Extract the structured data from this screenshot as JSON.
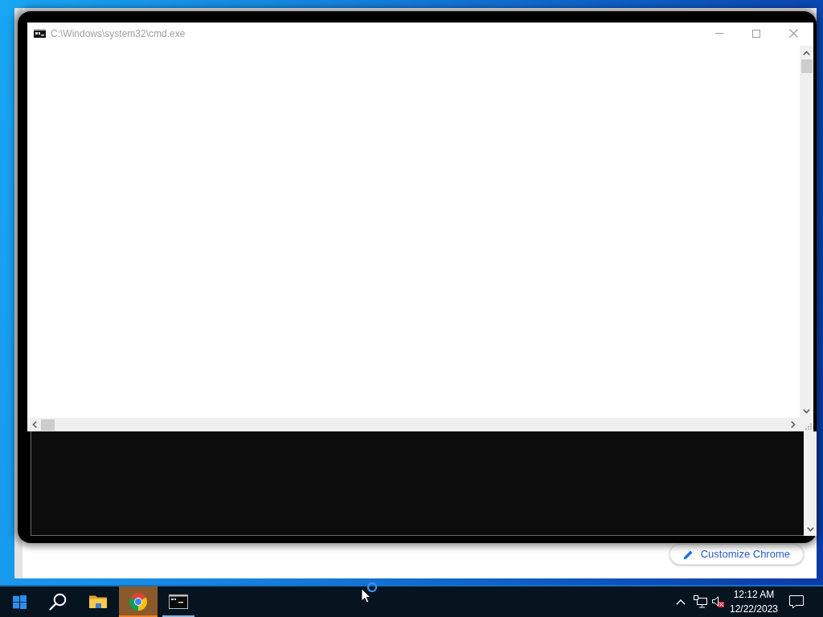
{
  "browser_window": {
    "customize_button": {
      "label": "Customize Chrome"
    }
  },
  "console_window": {
    "title": "C:\\Windows\\system32\\cmd.exe"
  },
  "taskbar": {
    "apps": [
      {
        "kind": "start",
        "running": false,
        "flashing": false
      },
      {
        "kind": "search",
        "running": false,
        "flashing": false
      },
      {
        "kind": "file-explorer",
        "running": false,
        "flashing": false
      },
      {
        "kind": "chrome",
        "running": true,
        "flashing": true
      },
      {
        "kind": "console",
        "running": true,
        "flashing": false
      }
    ],
    "clock": {
      "time": "12:12 AM",
      "date": "12/22/2023"
    }
  }
}
